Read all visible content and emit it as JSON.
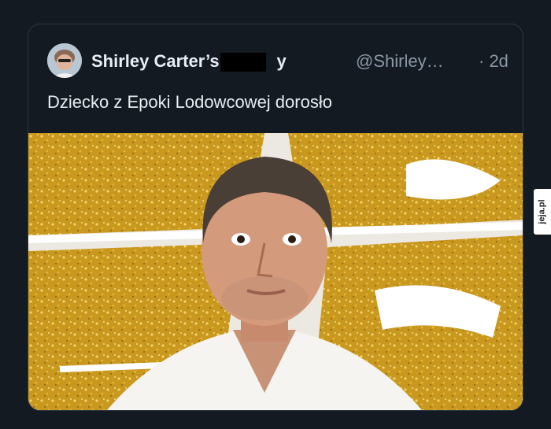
{
  "tweet": {
    "author_name": "Shirley Carter’s P",
    "author_name_suffix": "y",
    "handle": "@Shirley…",
    "time": "· 2d",
    "text": "Dziecko z Epoki Lodowcowej dorosło"
  },
  "watermark": {
    "text": "jeja.pl"
  },
  "colors": {
    "background": "#141a22",
    "border": "#2c3642",
    "gold": "#c9981e",
    "secondary_text": "#8b98a5"
  }
}
